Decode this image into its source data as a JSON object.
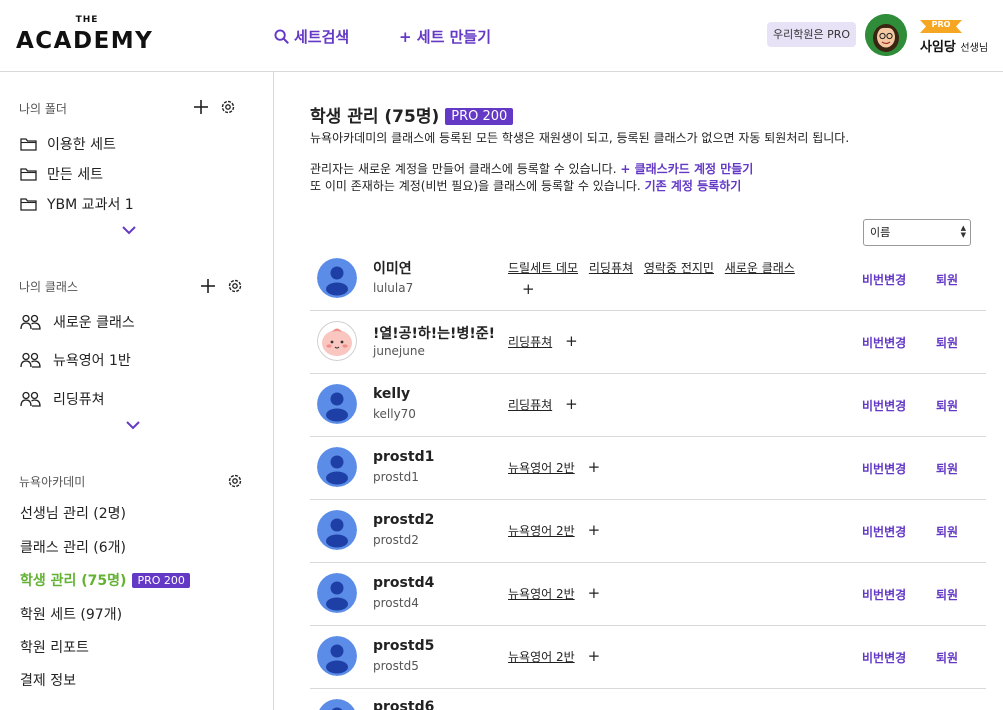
{
  "header": {
    "logo_small": "THE",
    "logo_main": "ACADEMY",
    "nav_search": "세트검색",
    "nav_create": "+ 세트 만들기",
    "pro_badge": "우리학원은 PRO",
    "ribbon": "PRO",
    "user_name": "사임당",
    "user_suffix": "선생님"
  },
  "sidebar": {
    "folders_title": "나의 폴더",
    "folders": [
      "이용한 세트",
      "만든 세트",
      "YBM 교과서 1"
    ],
    "classes_title": "나의 클래스",
    "classes": [
      "새로운 클래스",
      "뉴욕영어 1반",
      "리딩퓨쳐"
    ],
    "academy_title": "뉴욕아카데미",
    "admin": {
      "teachers": "선생님 관리 (2명)",
      "classes": "클래스 관리 (6개)",
      "students": "학생 관리 (75명)",
      "students_pro": "PRO 200",
      "sets": "학원 세트 (97개)",
      "report": "학원 리포트",
      "billing": "결제 정보"
    }
  },
  "main": {
    "title": "학생 관리 (75명)",
    "title_pro": "PRO 200",
    "desc1": "뉴욕아카데미의 클래스에 등록된 모든 학생은 재원생이 되고, 등록된 클래스가 없으면 자동 퇴원처리 됩니다.",
    "desc2": "관리자는 새로운 계정을 만들어 클래스에 등록할 수 있습니다.",
    "desc2_link": "+ 클래스카드 계정 만들기",
    "desc3": "또 이미 존재하는 계정(비번 필요)을 클래스에 등록할 수 있습니다.",
    "desc3_link": "기존 계정 등록하기",
    "sort_value": "이름",
    "action_password": "비번변경",
    "action_withdraw": "퇴원",
    "plus": "+",
    "students": [
      {
        "name": "이미연",
        "id": "lulula7",
        "classes": [
          "드릴세트 데모",
          "리딩퓨쳐",
          "영락중 전지민",
          "새로운 클래스"
        ],
        "avatar": "default"
      },
      {
        "name": "!열!공!하!는!병!준!",
        "id": "junejune",
        "classes": [
          "리딩퓨쳐"
        ],
        "avatar": "peach"
      },
      {
        "name": "kelly",
        "id": "kelly70",
        "classes": [
          "리딩퓨쳐"
        ],
        "avatar": "default"
      },
      {
        "name": "prostd1",
        "id": "prostd1",
        "classes": [
          "뉴욕영어 2반"
        ],
        "avatar": "default"
      },
      {
        "name": "prostd2",
        "id": "prostd2",
        "classes": [
          "뉴욕영어 2반"
        ],
        "avatar": "default"
      },
      {
        "name": "prostd4",
        "id": "prostd4",
        "classes": [
          "뉴욕영어 2반"
        ],
        "avatar": "default"
      },
      {
        "name": "prostd5",
        "id": "prostd5",
        "classes": [
          "뉴욕영어 2반"
        ],
        "avatar": "default"
      },
      {
        "name": "prostd6",
        "id": "",
        "classes": [],
        "avatar": "default"
      }
    ]
  },
  "colors": {
    "accent": "#6339c6",
    "active_green": "#63b234",
    "avatar_blue": "#5b8de8",
    "ribbon_orange": "#f5a623"
  },
  "icons": {
    "search": "search-icon",
    "folder": "folder-icon",
    "people": "people-icon",
    "plus": "plus-icon",
    "gear": "gear-icon",
    "chevron": "chevron-down-icon"
  }
}
